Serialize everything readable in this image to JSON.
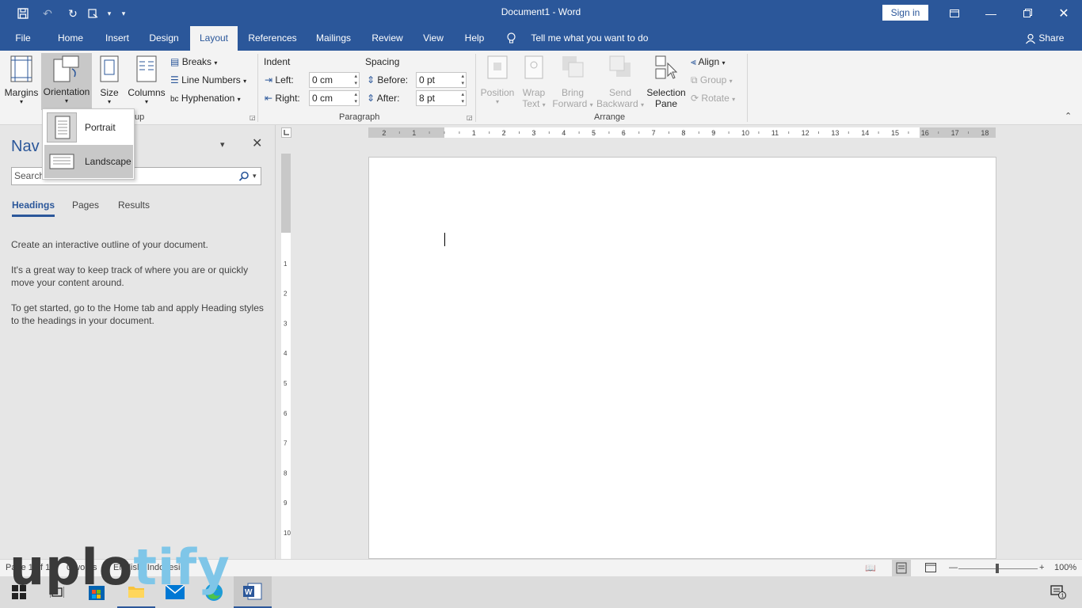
{
  "window": {
    "title": "Document1  -  Word",
    "sign_in": "Sign in"
  },
  "tabs": [
    "File",
    "Home",
    "Insert",
    "Design",
    "Layout",
    "References",
    "Mailings",
    "Review",
    "View",
    "Help"
  ],
  "active_tab": "Layout",
  "tell_me": "Tell me what you want to do",
  "share": "Share",
  "ribbon": {
    "margins": "Margins",
    "orientation": "Orientation",
    "size": "Size",
    "columns": "Columns",
    "breaks": "Breaks",
    "line_numbers": "Line Numbers",
    "hyphenation": "Hyphenation",
    "page_setup_label_partial": "up",
    "indent": {
      "title": "Indent",
      "left_label": "Left:",
      "left_value": "0 cm",
      "right_label": "Right:",
      "right_value": "0 cm"
    },
    "spacing": {
      "title": "Spacing",
      "before_label": "Before:",
      "before_value": "0 pt",
      "after_label": "After:",
      "after_value": "8 pt"
    },
    "paragraph_label": "Paragraph",
    "arrange": {
      "position": "Position",
      "wrap_text_1": "Wrap",
      "wrap_text_2": "Text",
      "bring_forward_1": "Bring",
      "bring_forward_2": "Forward",
      "send_backward_1": "Send",
      "send_backward_2": "Backward",
      "selection_pane_1": "Selection",
      "selection_pane_2": "Pane",
      "align": "Align",
      "group": "Group",
      "rotate": "Rotate",
      "label": "Arrange"
    }
  },
  "orientation_menu": {
    "portrait": "Portrait",
    "landscape": "Landscape"
  },
  "nav_pane": {
    "title": "Nav",
    "search_placeholder": "Search",
    "tabs": {
      "headings": "Headings",
      "pages": "Pages",
      "results": "Results"
    },
    "p1": "Create an interactive outline of your document.",
    "p2": "It's a great way to keep track of where you are or quickly move your content around.",
    "p3": "To get started, go to the Home tab and apply Heading styles to the headings in your document."
  },
  "ruler_numbers": [
    "2",
    "1",
    "1",
    "2",
    "3",
    "4",
    "5",
    "6",
    "7",
    "8",
    "9",
    "10",
    "11",
    "12",
    "13",
    "14",
    "15",
    "16",
    "17",
    "18"
  ],
  "vruler_numbers": [
    "2",
    "1",
    "1",
    "2",
    "3",
    "4",
    "5",
    "6",
    "7",
    "8",
    "9",
    "10"
  ],
  "status": {
    "page": "Page 1 of 1",
    "words": "0 words",
    "language": "English (Indonesia)",
    "zoom": "100%"
  },
  "watermark": {
    "part1": "uplo",
    "part2": "tify"
  },
  "colors": {
    "accent": "#2b579a",
    "ribbon_bg": "#f3f3f3"
  }
}
